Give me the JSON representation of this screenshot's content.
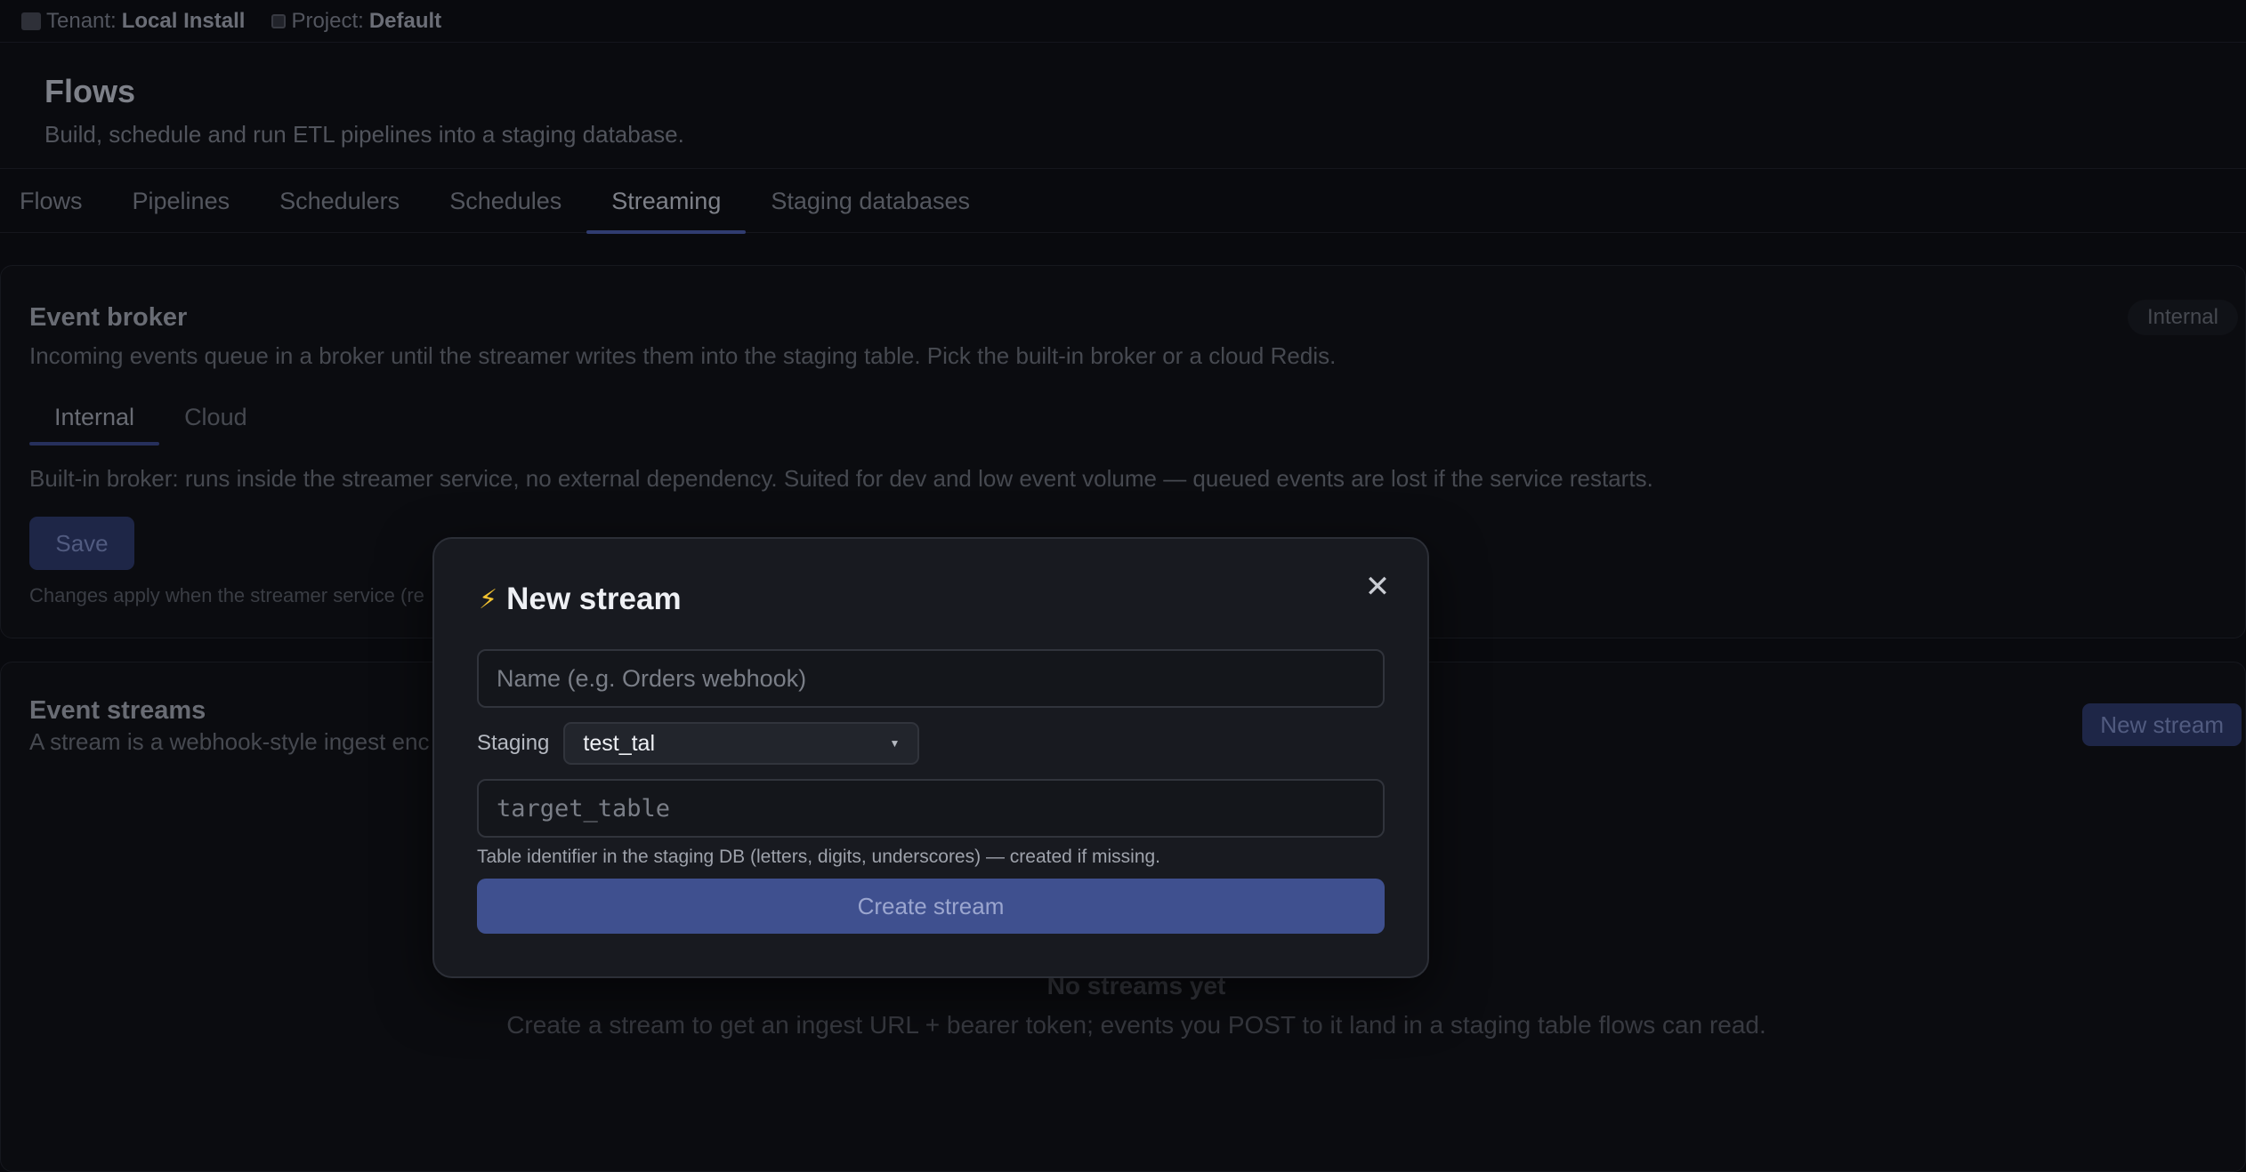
{
  "topbar": {
    "tenant_label": "Tenant:",
    "tenant_value": "Local Install",
    "project_label": "Project:",
    "project_value": "Default"
  },
  "header": {
    "title": "Flows",
    "subtitle": "Build, schedule and run ETL pipelines into a staging database."
  },
  "tabs": [
    "Flows",
    "Pipelines",
    "Schedulers",
    "Schedules",
    "Streaming",
    "Staging databases"
  ],
  "active_tab": "Streaming",
  "broker": {
    "title": "Event broker",
    "badge": "Internal",
    "description": "Incoming events queue in a broker until the streamer writes them into the staging table. Pick the built-in broker or a cloud Redis.",
    "subtabs": [
      "Internal",
      "Cloud"
    ],
    "active_subtab": "Internal",
    "note": "Built-in broker: runs inside the streamer service, no external dependency. Suited for dev and low event volume — queued events are lost if the service restarts.",
    "save_label": "Save",
    "apply_note": "Changes apply when the streamer service (re"
  },
  "streams": {
    "title": "Event streams",
    "description": "A stream is a webhook-style ingest enc",
    "new_button": "New stream",
    "empty_title": "No streams yet",
    "empty_desc": "Create a stream to get an ingest URL + bearer token; events you POST to it land in a staging table flows can read."
  },
  "modal": {
    "icon": "lightning-icon",
    "title": "New stream",
    "name_placeholder": "Name (e.g. Orders webhook)",
    "name_value": "",
    "staging_label": "Staging",
    "staging_value": "test_tal",
    "table_placeholder": "target_table",
    "table_value": "",
    "hint": "Table identifier in the staging DB (letters, digits, underscores) — created if missing.",
    "create_label": "Create stream"
  },
  "colors": {
    "accent": "#3f508f",
    "bolt": "#f2c230"
  }
}
